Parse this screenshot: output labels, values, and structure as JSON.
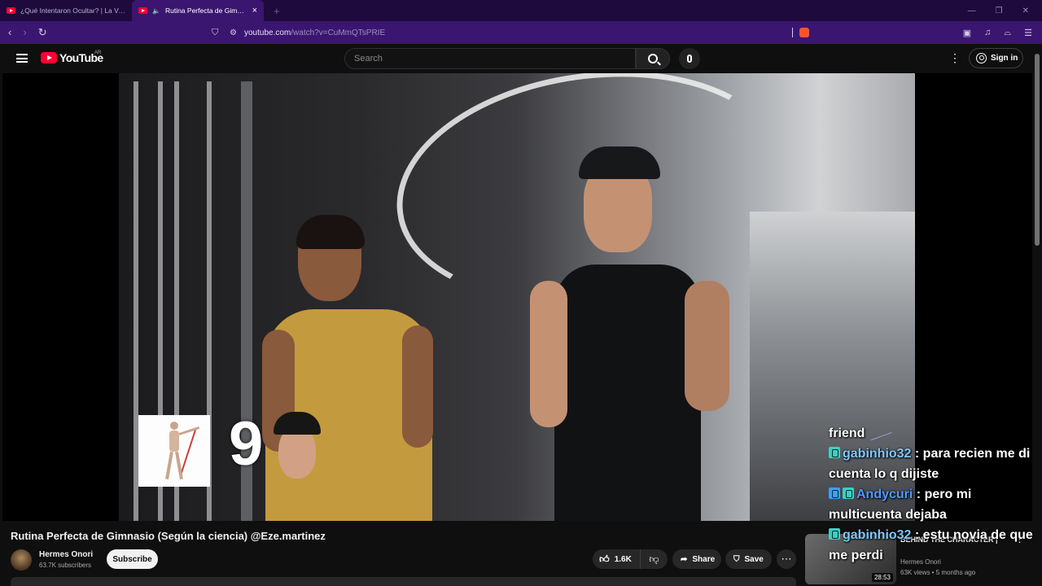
{
  "browser": {
    "tabs": [
      {
        "title": "¿Qué Intentaron Ocultar? | La Verdad",
        "active": false
      },
      {
        "title": "Rutina Perfecta de Gimnasio (",
        "active": true
      }
    ],
    "new_tab": "+",
    "url_host": "youtube.com",
    "url_path": "/watch?v=CuMmQTsPRIE"
  },
  "header": {
    "logo_text": "YouTube",
    "country": "AR",
    "search_placeholder": "Search",
    "signin_label": "Sign in"
  },
  "overlay": {
    "counter": "9"
  },
  "chat": [
    {
      "user": "",
      "message": "friend"
    },
    {
      "user": "gabinhio32",
      "message": ": para recien me di cuenta lo q dijiste"
    },
    {
      "user": "Andycuri",
      "message": ": pero mi multicuenta dejaba"
    },
    {
      "user": "gabinhio32",
      "message": ": estu novia de que me perdi"
    }
  ],
  "video": {
    "title": "Rutina Perfecta de Gimnasio (Según la ciencia) @Eze.martinez",
    "channel": "Hermes Onori",
    "subscribers": "63.7K subscribers",
    "subscribe_label": "Subscribe",
    "likes": "1.6K",
    "share_label": "Share",
    "save_label": "Save"
  },
  "recommendation": {
    "title": "BEHIND THE CHARACTER |",
    "channel": "Hermes Onori",
    "meta": "63K views • 5 months ago",
    "duration": "28:53"
  }
}
